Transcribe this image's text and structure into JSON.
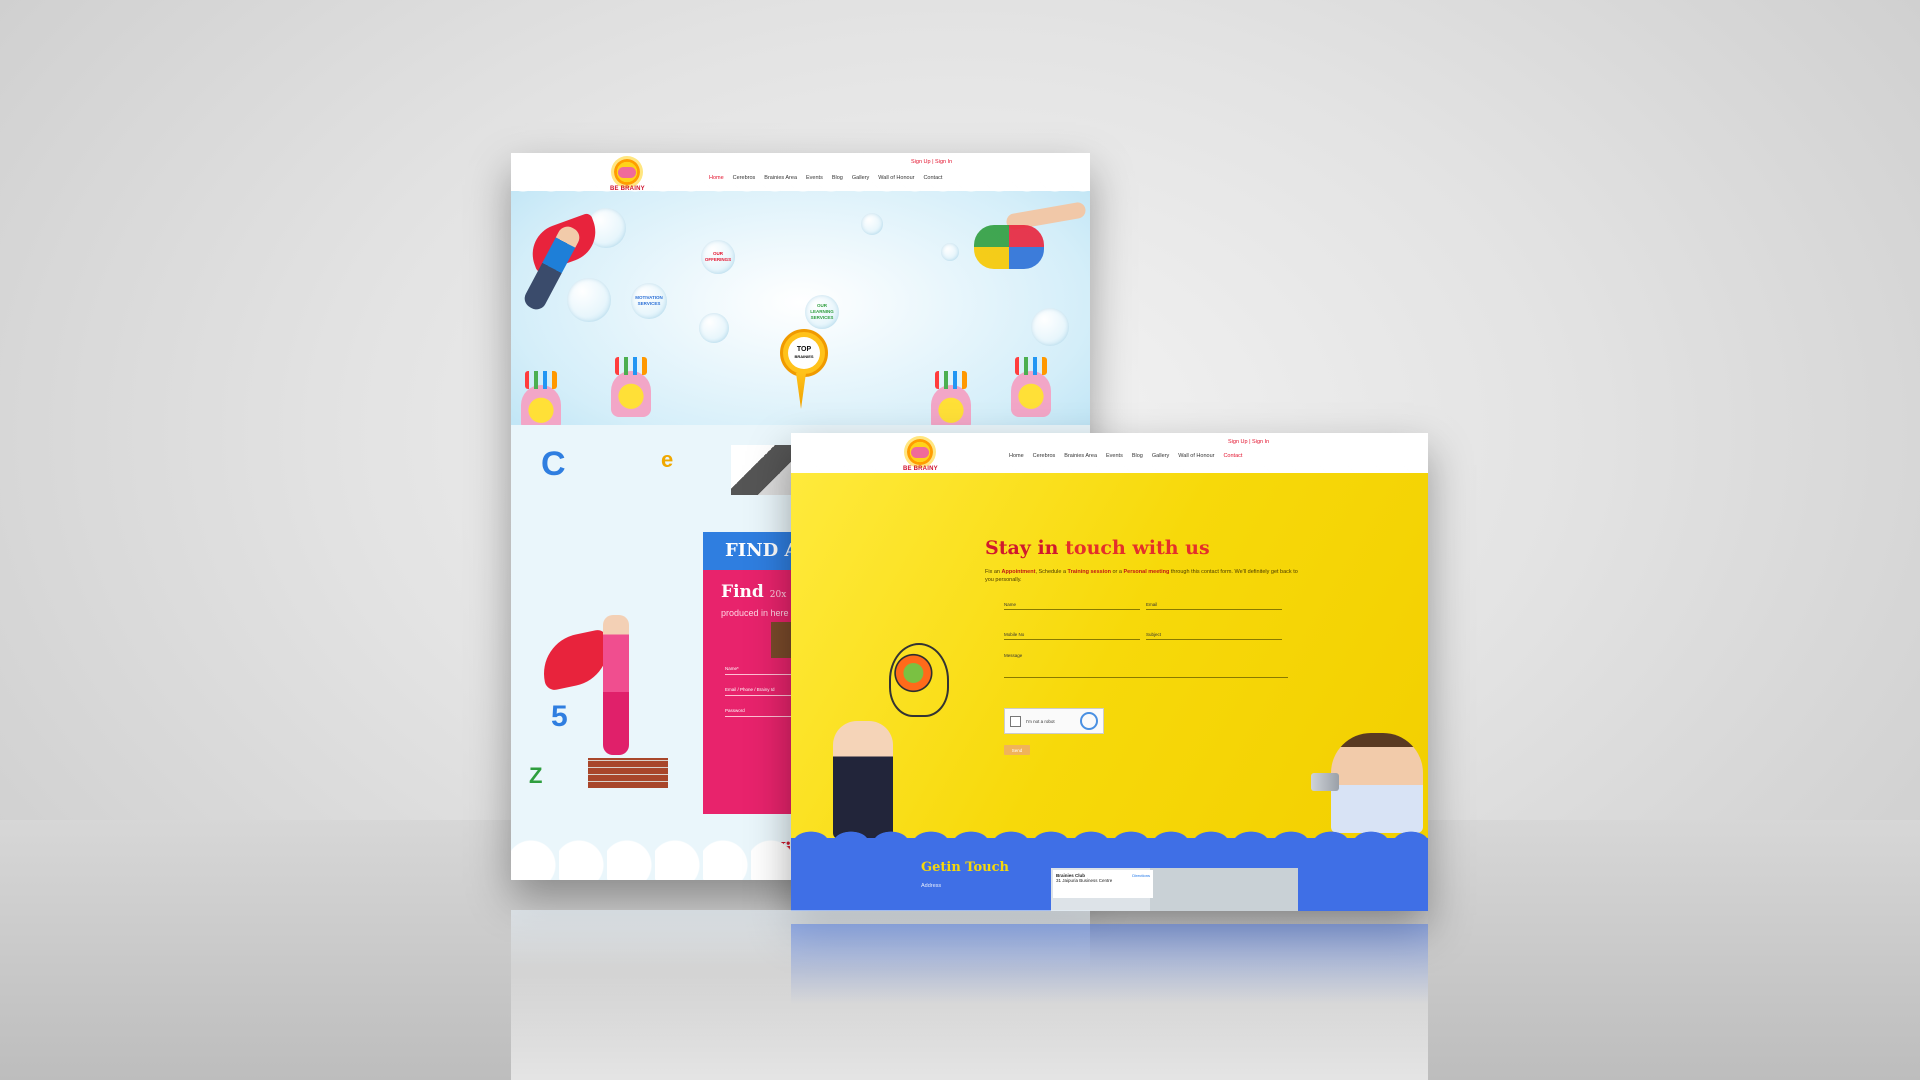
{
  "back_site": {
    "auth": "Sign Up | Sign In",
    "logo_text": "BE BRAINY",
    "nav": [
      "Home",
      "Cerebros",
      "Brainies Area",
      "Events",
      "Blog",
      "Gallery",
      "Wall of Honour",
      "Contact"
    ],
    "active_nav": "Home",
    "bubbles": [
      {
        "text": "OUR\nOFFERINGS",
        "color": "#e3122d"
      },
      {
        "text": "MOTIVATION\nSERVICES",
        "color": "#2a6fd6"
      },
      {
        "text": "OUR\nLEARNING\nSERVICES",
        "color": "#2e9e3e"
      }
    ],
    "pin_title": "TOP",
    "pin_sub": "BRAINIES",
    "find_banner": "FIND A",
    "find_heading": "Find",
    "find_heading_suffix": "20x",
    "find_sub": "produced in here",
    "form_fields": [
      "Name*",
      "Email / Phone / Brainy Id",
      "Password"
    ],
    "bottom_heading": "Wi",
    "letters": [
      "C",
      "e",
      "5",
      "Z"
    ]
  },
  "front_site": {
    "auth": "Sign Up | Sign In",
    "logo_text": "BE BRAINY",
    "nav": [
      "Home",
      "Cerebros",
      "Brainies Area",
      "Events",
      "Blog",
      "Gallery",
      "Wall of Honour",
      "Contact"
    ],
    "active_nav": "Contact",
    "title_part1": "Stay in",
    "title_part2": " touch with us",
    "intro_prefix": "Fix an ",
    "intro_appointment": "Appointment",
    "intro_mid1": ", Schedule a ",
    "intro_training": "Training session",
    "intro_mid2": " or a ",
    "intro_personal": "Personal meeting",
    "intro_suffix": " through this contact form. We'll definitely get back to you personally.",
    "fields": {
      "name": "Name",
      "email": "Email",
      "mobile": "Mobile No",
      "subject": "Subject",
      "message": "Message"
    },
    "captcha_label": "I'm not a robot",
    "send_label": "Send",
    "getin_title": "Getin Touch",
    "address_label": "Address",
    "map_card_title": "Brainies Club",
    "map_card_line": "31 Jaipuria Business Centre",
    "map_card_dir": "Directions"
  }
}
